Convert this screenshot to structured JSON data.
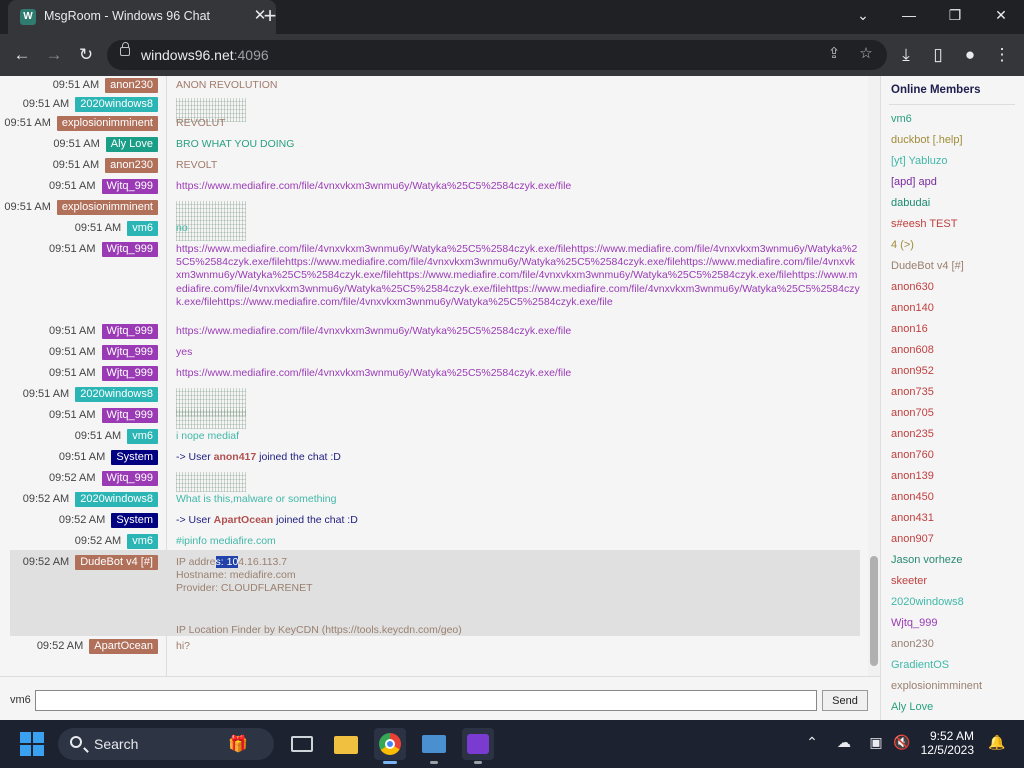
{
  "browser": {
    "tab_title": "MsgRoom - Windows 96 Chat",
    "tab_favicon": "W",
    "url_host": "windows96.net",
    "url_port": ":4096"
  },
  "chat": {
    "messages": [
      {
        "time": "09:51 AM",
        "user": "anon230",
        "style": "anon",
        "text": "ANON REVOLUTION",
        "kind": "text"
      },
      {
        "time": "09:51 AM",
        "user": "2020windows8",
        "style": "2020",
        "text": "",
        "kind": "art"
      },
      {
        "time": "09:51 AM",
        "user": "explosionimminent",
        "style": "expl",
        "text": "REVOLUT",
        "kind": "text"
      },
      {
        "time": "09:51 AM",
        "user": "Aly Love",
        "style": "aly",
        "text": "BRO WHAT YOU DOING",
        "kind": "text"
      },
      {
        "time": "09:51 AM",
        "user": "anon230",
        "style": "anon",
        "text": "REVOLT",
        "kind": "text"
      },
      {
        "time": "09:51 AM",
        "user": "Wjtq_999",
        "style": "wjtq",
        "text": "https://www.mediafire.com/file/4vnxvkxm3wnmu6y/Watyka%25C5%2584czyk.exe/file",
        "kind": "text"
      },
      {
        "time": "09:51 AM",
        "user": "explosionimminent",
        "style": "expl",
        "text": "",
        "kind": "art"
      },
      {
        "time": "09:51 AM",
        "user": "vm6",
        "style": "vm6",
        "text": "no",
        "kind": "text"
      },
      {
        "time": "09:51 AM",
        "user": "Wjtq_999",
        "style": "wjtq",
        "text": "https://www.mediafire.com/file/4vnxvkxm3wnmu6y/Watyka%25C5%2584czyk.exe/filehttps://www.mediafire.com/file/4vnxvkxm3wnmu6y/Watyka%25C5%2584czyk.exe/filehttps://www.mediafire.com/file/4vnxvkxm3wnmu6y/Watyka%25C5%2584czyk.exe/filehttps://www.mediafire.com/file/4vnxvkxm3wnmu6y/Watyka%25C5%2584czyk.exe/filehttps://www.mediafire.com/file/4vnxvkxm3wnmu6y/Watyka%25C5%2584czyk.exe/filehttps://www.mediafire.com/file/4vnxvkxm3wnmu6y/Watyka%25C5%2584czyk.exe/filehttps://www.mediafire.com/file/4vnxvkxm3wnmu6y/Watyka%25C5%2584czyk.exe/filehttps://www.mediafire.com/file/4vnxvkxm3wnmu6y/Watyka%25C5%2584czyk.exe/file",
        "kind": "text"
      },
      {
        "time": "09:51 AM",
        "user": "Wjtq_999",
        "style": "wjtq",
        "text": "https://www.mediafire.com/file/4vnxvkxm3wnmu6y/Watyka%25C5%2584czyk.exe/file",
        "kind": "text"
      },
      {
        "time": "09:51 AM",
        "user": "Wjtq_999",
        "style": "wjtq",
        "text": "yes",
        "kind": "text"
      },
      {
        "time": "09:51 AM",
        "user": "Wjtq_999",
        "style": "wjtq",
        "text": "https://www.mediafire.com/file/4vnxvkxm3wnmu6y/Watyka%25C5%2584czyk.exe/file",
        "kind": "text"
      },
      {
        "time": "09:51 AM",
        "user": "2020windows8",
        "style": "2020",
        "text": "",
        "kind": "art"
      },
      {
        "time": "09:51 AM",
        "user": "Wjtq_999",
        "style": "wjtq",
        "text": "",
        "kind": "art"
      },
      {
        "time": "09:51 AM",
        "user": "vm6",
        "style": "vm6",
        "text": "i nope mediaf",
        "kind": "text"
      },
      {
        "time": "09:51 AM",
        "user": "System",
        "style": "sys",
        "text_pre": "-> User ",
        "text_user": "anon417",
        "text_post": " joined the chat :D",
        "kind": "system"
      },
      {
        "time": "09:52 AM",
        "user": "Wjtq_999",
        "style": "wjtq",
        "text": "",
        "kind": "art"
      },
      {
        "time": "09:52 AM",
        "user": "2020windows8",
        "style": "2020",
        "text": "What is this,malware or something",
        "kind": "text"
      },
      {
        "time": "09:52 AM",
        "user": "System",
        "style": "sys",
        "text_pre": "-> User ",
        "text_user": "ApartOcean",
        "text_post": " joined the chat :D",
        "kind": "system"
      },
      {
        "time": "09:52 AM",
        "user": "vm6",
        "style": "vm6",
        "text": "#ipinfo mediafire.com",
        "kind": "text"
      },
      {
        "time": "09:52 AM",
        "user": "DudeBot v4 [#]",
        "style": "dude",
        "kind": "bot",
        "ip_label": "IP addre",
        "ip_selected": "s: 10",
        "ip_rest": "4.16.113.7",
        "hostname": "Hostname: mediafire.com",
        "provider": "Provider: CLOUDFLARENET",
        "footer": "IP Location Finder by KeyCDN (https://tools.keycdn.com/geo)"
      },
      {
        "time": "09:52 AM",
        "user": "ApartOcean",
        "style": "apart",
        "text": "hi?",
        "kind": "text"
      }
    ]
  },
  "members": {
    "title": "Online Members",
    "list": [
      {
        "name": "vm6",
        "color": "#2aa080"
      },
      {
        "name": "duckbot [.help]",
        "color": "#a08c3a"
      },
      {
        "name": "[yt] Yabluzo",
        "color": "#40b8a8"
      },
      {
        "name": "[apd] apd",
        "color": "#7a2aa0"
      },
      {
        "name": "dabudai",
        "color": "#1a8a70"
      },
      {
        "name": "s#eesh TEST",
        "color": "#c04040"
      },
      {
        "name": "4 (>)",
        "color": "#a08c3a"
      },
      {
        "name": "DudeBot v4 [#]",
        "color": "#9a8070"
      },
      {
        "name": "anon630",
        "color": "#c04040"
      },
      {
        "name": "anon140",
        "color": "#c04040"
      },
      {
        "name": "anon16",
        "color": "#c04040"
      },
      {
        "name": "anon608",
        "color": "#c04040"
      },
      {
        "name": "anon952",
        "color": "#c04040"
      },
      {
        "name": "anon735",
        "color": "#c04040"
      },
      {
        "name": "anon705",
        "color": "#c04040"
      },
      {
        "name": "anon235",
        "color": "#c04040"
      },
      {
        "name": "anon760",
        "color": "#c04040"
      },
      {
        "name": "anon139",
        "color": "#c04040"
      },
      {
        "name": "anon450",
        "color": "#c04040"
      },
      {
        "name": "anon431",
        "color": "#c04040"
      },
      {
        "name": "anon907",
        "color": "#c04040"
      },
      {
        "name": "Jason vorheze",
        "color": "#2a8a70"
      },
      {
        "name": "skeeter",
        "color": "#c04040"
      },
      {
        "name": "2020windows8",
        "color": "#40b8a8"
      },
      {
        "name": "Wjtq_999",
        "color": "#9a3bb5"
      },
      {
        "name": "anon230",
        "color": "#9a8070"
      },
      {
        "name": "GradientOS",
        "color": "#40b8a8"
      },
      {
        "name": "explosionimminent",
        "color": "#9a8070"
      },
      {
        "name": "Aly Love",
        "color": "#2aa080"
      }
    ]
  },
  "composer": {
    "nick": "vm6",
    "input_value": "",
    "send_label": "Send"
  },
  "taskbar": {
    "search_label": "Search",
    "time": "9:52 AM",
    "date": "12/5/2023"
  }
}
